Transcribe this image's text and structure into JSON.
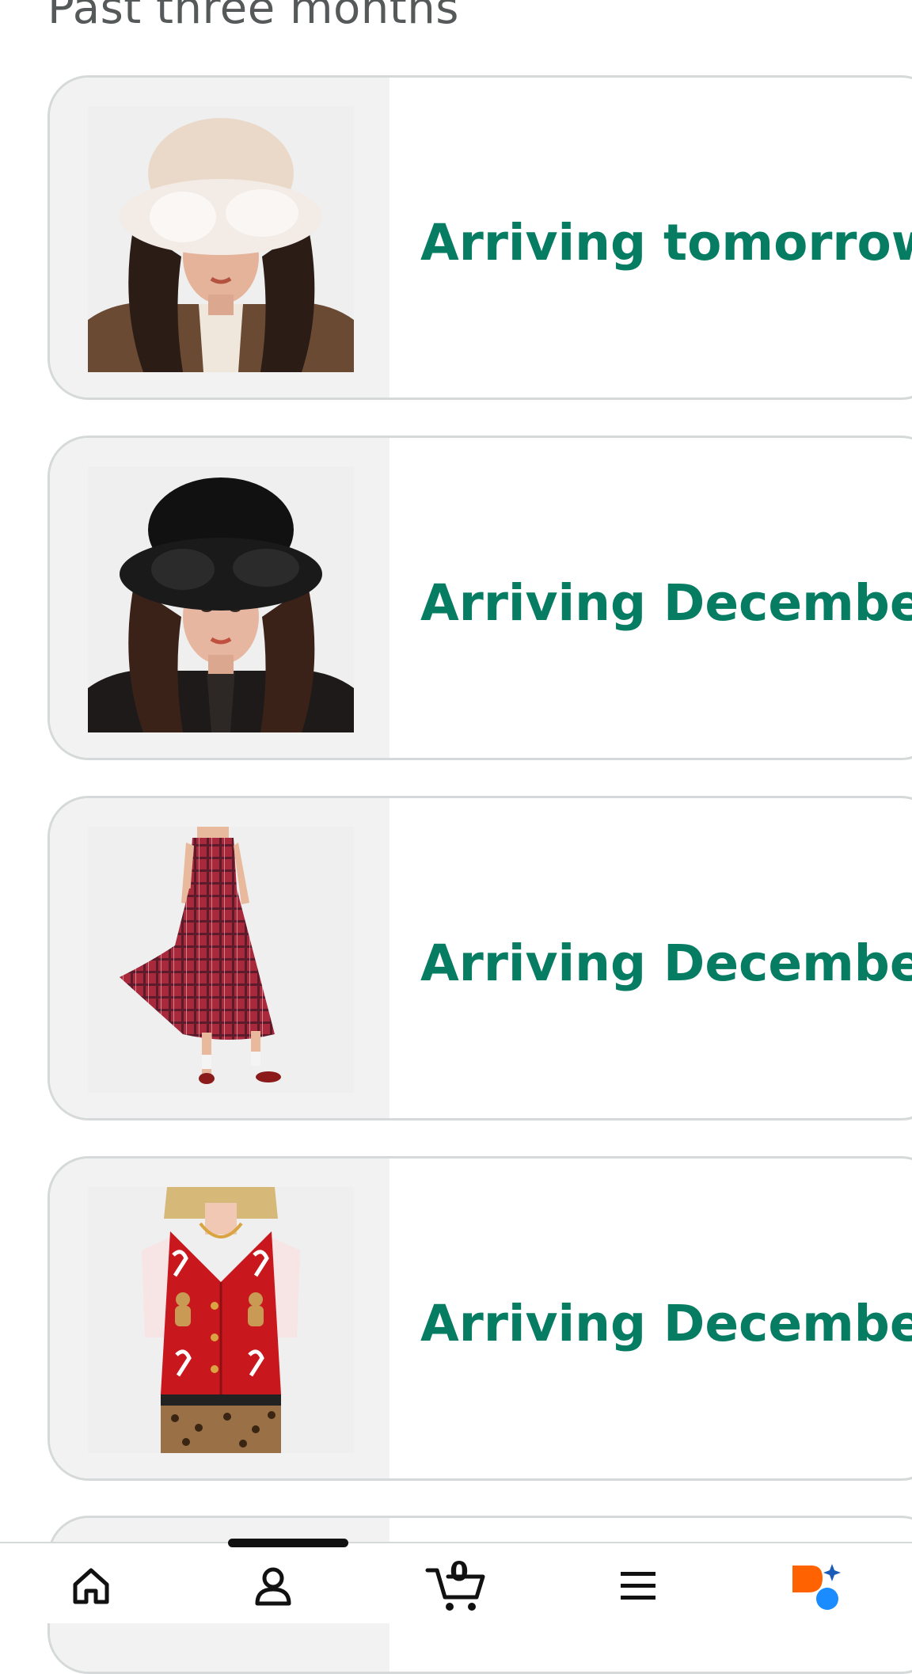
{
  "section_heading": "Past three months",
  "orders": [
    {
      "status": "Arriving tomorrow",
      "product_image": "woman-in-cream-faux-fur-bucket-hat"
    },
    {
      "status": "Arriving December ",
      "product_image": "woman-in-black-faux-fur-bucket-hat"
    },
    {
      "status": "Arriving December ",
      "product_image": "red-plaid-smocked-tiered-dress"
    },
    {
      "status": "Arriving December",
      "product_image": "red-gingerbread-candy-cane-sweater-vest"
    }
  ],
  "bottom_nav": {
    "items": [
      {
        "icon": "home-icon"
      },
      {
        "icon": "account-icon"
      },
      {
        "icon": "cart-icon",
        "count": "0"
      },
      {
        "icon": "menu-icon"
      },
      {
        "icon": "rufus-assistant-icon"
      }
    ]
  },
  "colors": {
    "status_text": "#067d62",
    "heading_text": "#565959",
    "card_border": "#d5d9d9",
    "thumb_bg": "#f2f2f2",
    "assistant_orange": "#ff6200",
    "assistant_blue": "#1a8cff"
  }
}
